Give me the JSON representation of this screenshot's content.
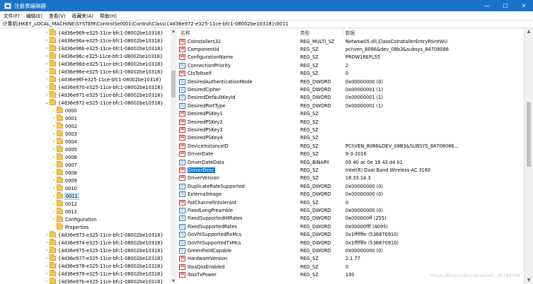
{
  "window": {
    "title": "注册表编辑器",
    "minimize_icon": "minimize-icon",
    "maximize_icon": "maximize-icon",
    "close_icon": "close-icon"
  },
  "menu": [
    "文件(F)",
    "编辑(E)",
    "查看(V)",
    "收藏夹(A)",
    "帮助(H)"
  ],
  "address": "计算机\\HKEY_LOCAL_MACHINE\\SYSTEM\\ControlSet001\\Control\\Class\\{4d36e972-e325-11ce-bfc1-08002be10318}\\0011",
  "tree": [
    {
      "label": "{4d36e969-e325-11ce-bfc1-08002be10318}",
      "expander": ">",
      "indent": 0
    },
    {
      "label": "{4d36e96a-e325-11ce-bfc1-08002be10318}",
      "expander": ">",
      "indent": 0
    },
    {
      "label": "{4d36e96b-e325-11ce-bfc1-08002be10318}",
      "expander": ">",
      "indent": 0
    },
    {
      "label": "{4d36e96c-e325-11ce-bfc1-08002be10318}",
      "expander": ">",
      "indent": 0
    },
    {
      "label": "{4d36e96d-e325-11ce-bfc1-08002be10318}",
      "expander": ">",
      "indent": 0
    },
    {
      "label": "{4d36e96e-e325-11ce-bfc1-08002be10318}",
      "expander": ">",
      "indent": 0
    },
    {
      "label": "{4d36e96f-e325-11ce-bfc1-08002be10318}",
      "expander": ">",
      "indent": 0
    },
    {
      "label": "{4d36e970-e325-11ce-bfc1-08002be10318}",
      "expander": ">",
      "indent": 0
    },
    {
      "label": "{4d36e971-e325-11ce-bfc1-08002be10318}",
      "expander": ">",
      "indent": 0
    },
    {
      "label": "{4d36e972-e325-11ce-bfc1-08002be10318}",
      "expander": "v",
      "indent": 0
    },
    {
      "label": "0000",
      "expander": ">",
      "indent": 1
    },
    {
      "label": "0001",
      "expander": ">",
      "indent": 1
    },
    {
      "label": "0002",
      "expander": ">",
      "indent": 1
    },
    {
      "label": "0003",
      "expander": ">",
      "indent": 1
    },
    {
      "label": "0004",
      "expander": ">",
      "indent": 1
    },
    {
      "label": "0005",
      "expander": ">",
      "indent": 1
    },
    {
      "label": "0006",
      "expander": ">",
      "indent": 1
    },
    {
      "label": "0007",
      "expander": ">",
      "indent": 1
    },
    {
      "label": "0008",
      "expander": ">",
      "indent": 1
    },
    {
      "label": "0009",
      "expander": ">",
      "indent": 1
    },
    {
      "label": "0010",
      "expander": ">",
      "indent": 1
    },
    {
      "label": "0011",
      "expander": ">",
      "indent": 1,
      "selected": true
    },
    {
      "label": "0012",
      "expander": ">",
      "indent": 1
    },
    {
      "label": "0013",
      "expander": ">",
      "indent": 1
    },
    {
      "label": "Configuration",
      "expander": ">",
      "indent": 1
    },
    {
      "label": "Properties",
      "expander": "",
      "indent": 1
    },
    {
      "label": "{4d36e973-e325-11ce-bfc1-08002be10318}",
      "expander": ">",
      "indent": 0
    },
    {
      "label": "{4d36e974-e325-11ce-bfc1-08002be10318}",
      "expander": ">",
      "indent": 0
    },
    {
      "label": "{4d36e975-e325-11ce-bfc1-08002be10318}",
      "expander": ">",
      "indent": 0
    },
    {
      "label": "{4d36e977-e325-11ce-bfc1-08002be10318}",
      "expander": ">",
      "indent": 0
    },
    {
      "label": "{4d36e978-e325-11ce-bfc1-08002be10318}",
      "expander": ">",
      "indent": 0
    },
    {
      "label": "{4d36e979-e325-11ce-bfc1-08002be10318}",
      "expander": ">",
      "indent": 0
    },
    {
      "label": "{4d36e97b-e325-11ce-bfc1-08002be10318}",
      "expander": ">",
      "indent": 0
    }
  ],
  "columns": {
    "name": "名称",
    "type": "类型",
    "data": "数据"
  },
  "values": [
    {
      "icon": "ab",
      "name": "CoInstallers32",
      "type": "REG_MULTI_SZ",
      "data": "Netwsw05.dll,ClassCoInstallerEntryPointWU"
    },
    {
      "icon": "ab",
      "name": "ComponentId",
      "type": "REG_SZ",
      "data": "pci\\ven_8086&dev_08b3&subsys_84708086"
    },
    {
      "icon": "ab",
      "name": "ConfigurationName",
      "type": "REG_SZ",
      "data": "PROW1REFL55"
    },
    {
      "icon": "bin",
      "name": "ConnectionPriority",
      "type": "REG_SZ",
      "data": "2"
    },
    {
      "icon": "ab",
      "name": "CtsToItself",
      "type": "REG_SZ",
      "data": "0"
    },
    {
      "icon": "bin",
      "name": "DesiredAuthenticationMode",
      "type": "REG_DWORD",
      "data": "0x00000000 (0)"
    },
    {
      "icon": "bin",
      "name": "DesiredCipher",
      "type": "REG_DWORD",
      "data": "0x00000001 (1)"
    },
    {
      "icon": "bin",
      "name": "DesiredDefaultKeyId",
      "type": "REG_DWORD",
      "data": "0x00000001 (1)"
    },
    {
      "icon": "bin",
      "name": "DesiredPortType",
      "type": "REG_DWORD",
      "data": "0x00000001 (1)"
    },
    {
      "icon": "ab",
      "name": "DesiredPSKey1",
      "type": "REG_SZ",
      "data": ""
    },
    {
      "icon": "ab",
      "name": "DesiredPSKey2",
      "type": "REG_SZ",
      "data": ""
    },
    {
      "icon": "ab",
      "name": "DesiredPSKey3",
      "type": "REG_SZ",
      "data": ""
    },
    {
      "icon": "ab",
      "name": "DesiredPSKey4",
      "type": "REG_SZ",
      "data": ""
    },
    {
      "icon": "ab",
      "name": "DeviceInstanceID",
      "type": "REG_SZ",
      "data": "PCI\\VEN_8086&DEV_08B3&SUBSYS_84708086..."
    },
    {
      "icon": "ab",
      "name": "DriverDate",
      "type": "REG_SZ",
      "data": "9-3-2016"
    },
    {
      "icon": "bin",
      "name": "DriverDateData",
      "type": "REG_BINARY",
      "data": "00 40 ac 0e 19 43 d4 01"
    },
    {
      "icon": "ab",
      "name": "DriverDesc",
      "type": "REG_SZ",
      "data": "Intel(R) Dual Band Wireless-AC 3160",
      "selected": true
    },
    {
      "icon": "ab",
      "name": "DriverVersion",
      "type": "REG_SZ",
      "data": "18.33.14.3"
    },
    {
      "icon": "bin",
      "name": "DuplicateRateSupported",
      "type": "REG_DWORD",
      "data": "0x00000000 (0)"
    },
    {
      "icon": "bin",
      "name": "ExternalImage",
      "type": "REG_DWORD",
      "data": "0x00000000 (0)"
    },
    {
      "icon": "ab",
      "name": "FatChannelIntolerant",
      "type": "REG_SZ",
      "data": "0"
    },
    {
      "icon": "bin",
      "name": "FixedLongPreamble",
      "type": "REG_DWORD",
      "data": "0x00000000 (0)"
    },
    {
      "icon": "bin",
      "name": "FixedSupportedHtRates",
      "type": "REG_DWORD",
      "data": "0x000000ff (255)"
    },
    {
      "icon": "bin",
      "name": "FixedSupportedRates",
      "type": "REG_DWORD",
      "data": "0x00000fff (4095)"
    },
    {
      "icon": "bin",
      "name": "GoVhtSupportedRxMcs",
      "type": "REG_DWORD",
      "data": "0x1ffffffe (536870910)"
    },
    {
      "icon": "bin",
      "name": "GoVhtSupportedTxMcs",
      "type": "REG_DWORD",
      "data": "0x1ffffffe (536870910)"
    },
    {
      "icon": "bin",
      "name": "GreenFieldCapable",
      "type": "REG_DWORD",
      "data": "0x00000000 (0)"
    },
    {
      "icon": "ab",
      "name": "HardwareVersion",
      "type": "REG_SZ",
      "data": "2.1.77"
    },
    {
      "icon": "ab",
      "name": "IbssQosEnabled",
      "type": "REG_SZ",
      "data": "0"
    },
    {
      "icon": "ab",
      "name": "IbssTxPower",
      "type": "REG_SZ",
      "data": "100"
    }
  ],
  "watermark": "https://blog.csdn.net/weixin_38789398"
}
